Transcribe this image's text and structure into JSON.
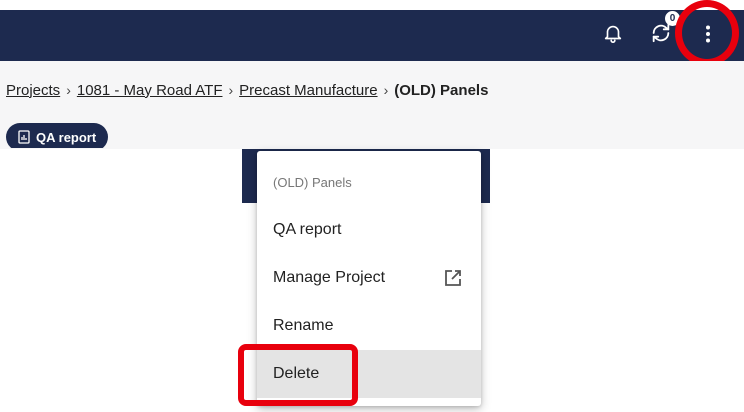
{
  "header": {
    "sync_badge": "0",
    "icons": [
      "bell-icon",
      "sync-icon",
      "more-vertical-icon"
    ],
    "background": "#1d2a4f"
  },
  "breadcrumb": {
    "items": [
      "Projects",
      "1081 - May Road ATF",
      "Precast Manufacture"
    ],
    "current": "(OLD) Panels"
  },
  "toolbar": {
    "qa_report_label": "QA report"
  },
  "menu": {
    "header": "(OLD) Panels",
    "items": [
      "QA report",
      "Manage Project",
      "Rename",
      "Delete"
    ]
  },
  "colors": {
    "highlight": "#e8000d",
    "hover": "#e4e4e4"
  }
}
